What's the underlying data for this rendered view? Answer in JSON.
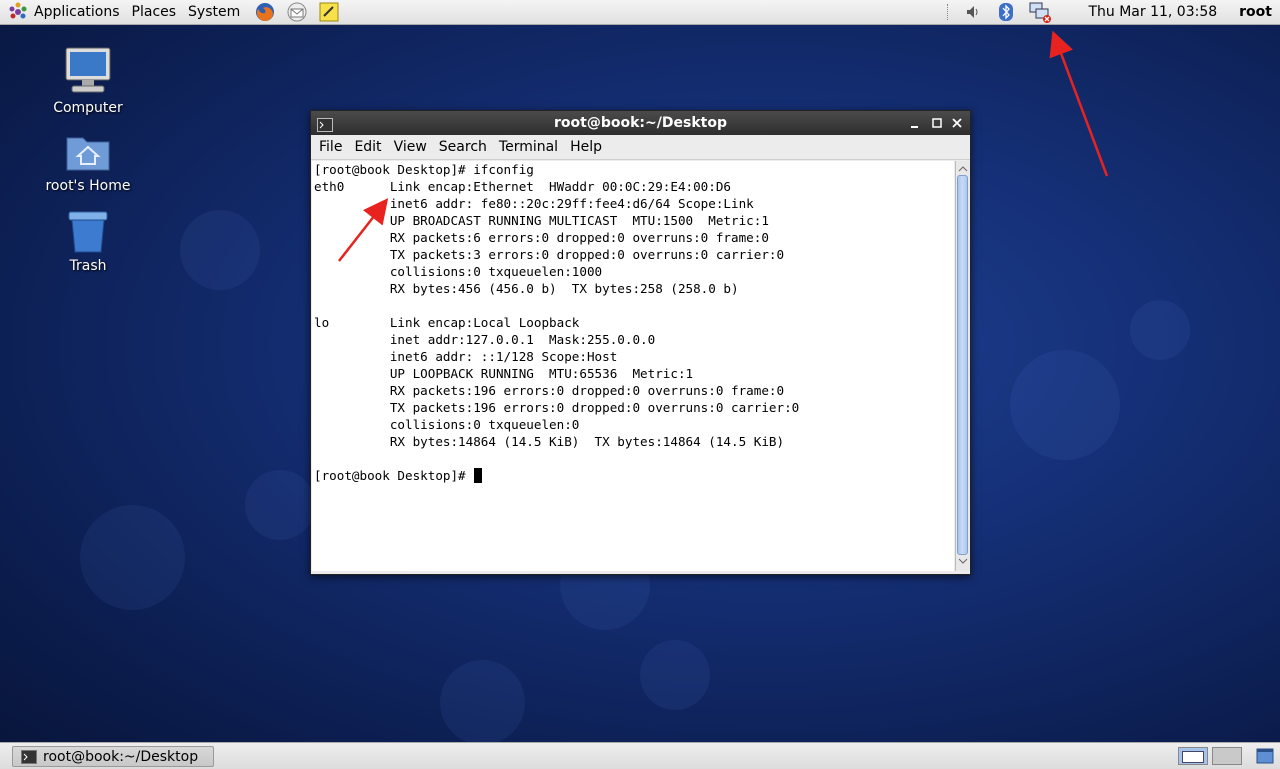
{
  "top_panel": {
    "menus": [
      "Applications",
      "Places",
      "System"
    ],
    "clock": "Thu Mar 11, 03:58",
    "user": "root"
  },
  "desktop_icons": [
    {
      "label": "Computer"
    },
    {
      "label": "root's Home"
    },
    {
      "label": "Trash"
    }
  ],
  "terminal": {
    "title": "root@book:~/Desktop",
    "menu": [
      "File",
      "Edit",
      "View",
      "Search",
      "Terminal",
      "Help"
    ],
    "lines": [
      "[root@book Desktop]# ifconfig",
      "eth0      Link encap:Ethernet  HWaddr 00:0C:29:E4:00:D6",
      "          inet6 addr: fe80::20c:29ff:fee4:d6/64 Scope:Link",
      "          UP BROADCAST RUNNING MULTICAST  MTU:1500  Metric:1",
      "          RX packets:6 errors:0 dropped:0 overruns:0 frame:0",
      "          TX packets:3 errors:0 dropped:0 overruns:0 carrier:0",
      "          collisions:0 txqueuelen:1000",
      "          RX bytes:456 (456.0 b)  TX bytes:258 (258.0 b)",
      "",
      "lo        Link encap:Local Loopback",
      "          inet addr:127.0.0.1  Mask:255.0.0.0",
      "          inet6 addr: ::1/128 Scope:Host",
      "          UP LOOPBACK RUNNING  MTU:65536  Metric:1",
      "          RX packets:196 errors:0 dropped:0 overruns:0 frame:0",
      "          TX packets:196 errors:0 dropped:0 overruns:0 carrier:0",
      "          collisions:0 txqueuelen:0",
      "          RX bytes:14864 (14.5 KiB)  TX bytes:14864 (14.5 KiB)",
      "",
      "[root@book Desktop]# "
    ]
  },
  "taskbar": {
    "task_label": "root@book:~/Desktop"
  },
  "colors": {
    "annotation_arrow": "#e8231f",
    "desktop_bg": "#142e73"
  }
}
